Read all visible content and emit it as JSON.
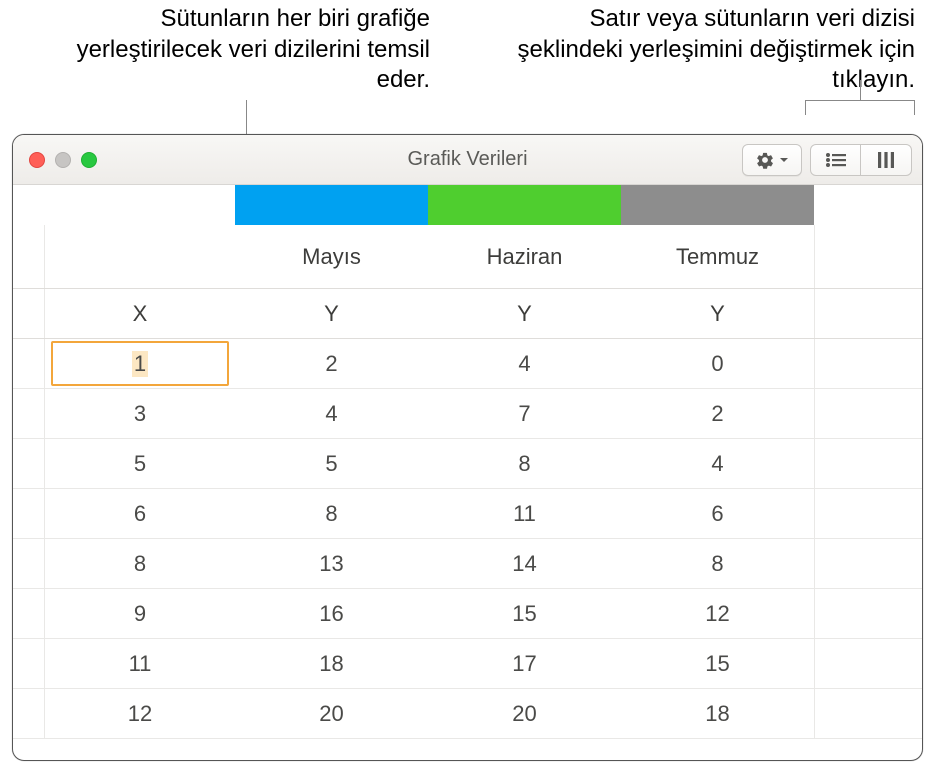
{
  "callouts": {
    "left": "Sütunların her biri grafiğe yerleştirilecek veri dizilerini temsil eder.",
    "right": "Satır veya sütunların veri dizisi şeklindeki yerleşimini değiştirmek için tıklayın."
  },
  "window": {
    "title": "Grafik Verileri"
  },
  "toolbar": {
    "gear_name": "gear-icon",
    "rows_name": "rows-orientation",
    "cols_name": "cols-orientation"
  },
  "colors": {
    "series": [
      "#00a1f1",
      "#4fce2f",
      "#8d8d8d"
    ]
  },
  "headers": {
    "series": [
      "Mayıs",
      "Haziran",
      "Temmuz"
    ],
    "axis_x": "X",
    "axis_y": "Y"
  },
  "rows": [
    {
      "x": "1",
      "y": [
        "2",
        "4",
        "0"
      ]
    },
    {
      "x": "3",
      "y": [
        "4",
        "7",
        "2"
      ]
    },
    {
      "x": "5",
      "y": [
        "5",
        "8",
        "4"
      ]
    },
    {
      "x": "6",
      "y": [
        "8",
        "11",
        "6"
      ]
    },
    {
      "x": "8",
      "y": [
        "13",
        "14",
        "8"
      ]
    },
    {
      "x": "9",
      "y": [
        "16",
        "15",
        "12"
      ]
    },
    {
      "x": "11",
      "y": [
        "18",
        "17",
        "15"
      ]
    },
    {
      "x": "12",
      "y": [
        "20",
        "20",
        "18"
      ]
    }
  ],
  "selected_cell": {
    "row": 0,
    "col": "x"
  },
  "chart_data": {
    "type": "table",
    "title": "Grafik Verileri",
    "x_label": "X",
    "series": [
      {
        "name": "Mayıs",
        "color": "#00a1f1",
        "x": [
          1,
          3,
          5,
          6,
          8,
          9,
          11,
          12
        ],
        "y": [
          2,
          4,
          5,
          8,
          13,
          16,
          18,
          20
        ]
      },
      {
        "name": "Haziran",
        "color": "#4fce2f",
        "x": [
          1,
          3,
          5,
          6,
          8,
          9,
          11,
          12
        ],
        "y": [
          4,
          7,
          8,
          11,
          14,
          15,
          17,
          20
        ]
      },
      {
        "name": "Temmuz",
        "color": "#8d8d8d",
        "x": [
          1,
          3,
          5,
          6,
          8,
          9,
          11,
          12
        ],
        "y": [
          0,
          2,
          4,
          6,
          8,
          12,
          15,
          18
        ]
      }
    ]
  }
}
